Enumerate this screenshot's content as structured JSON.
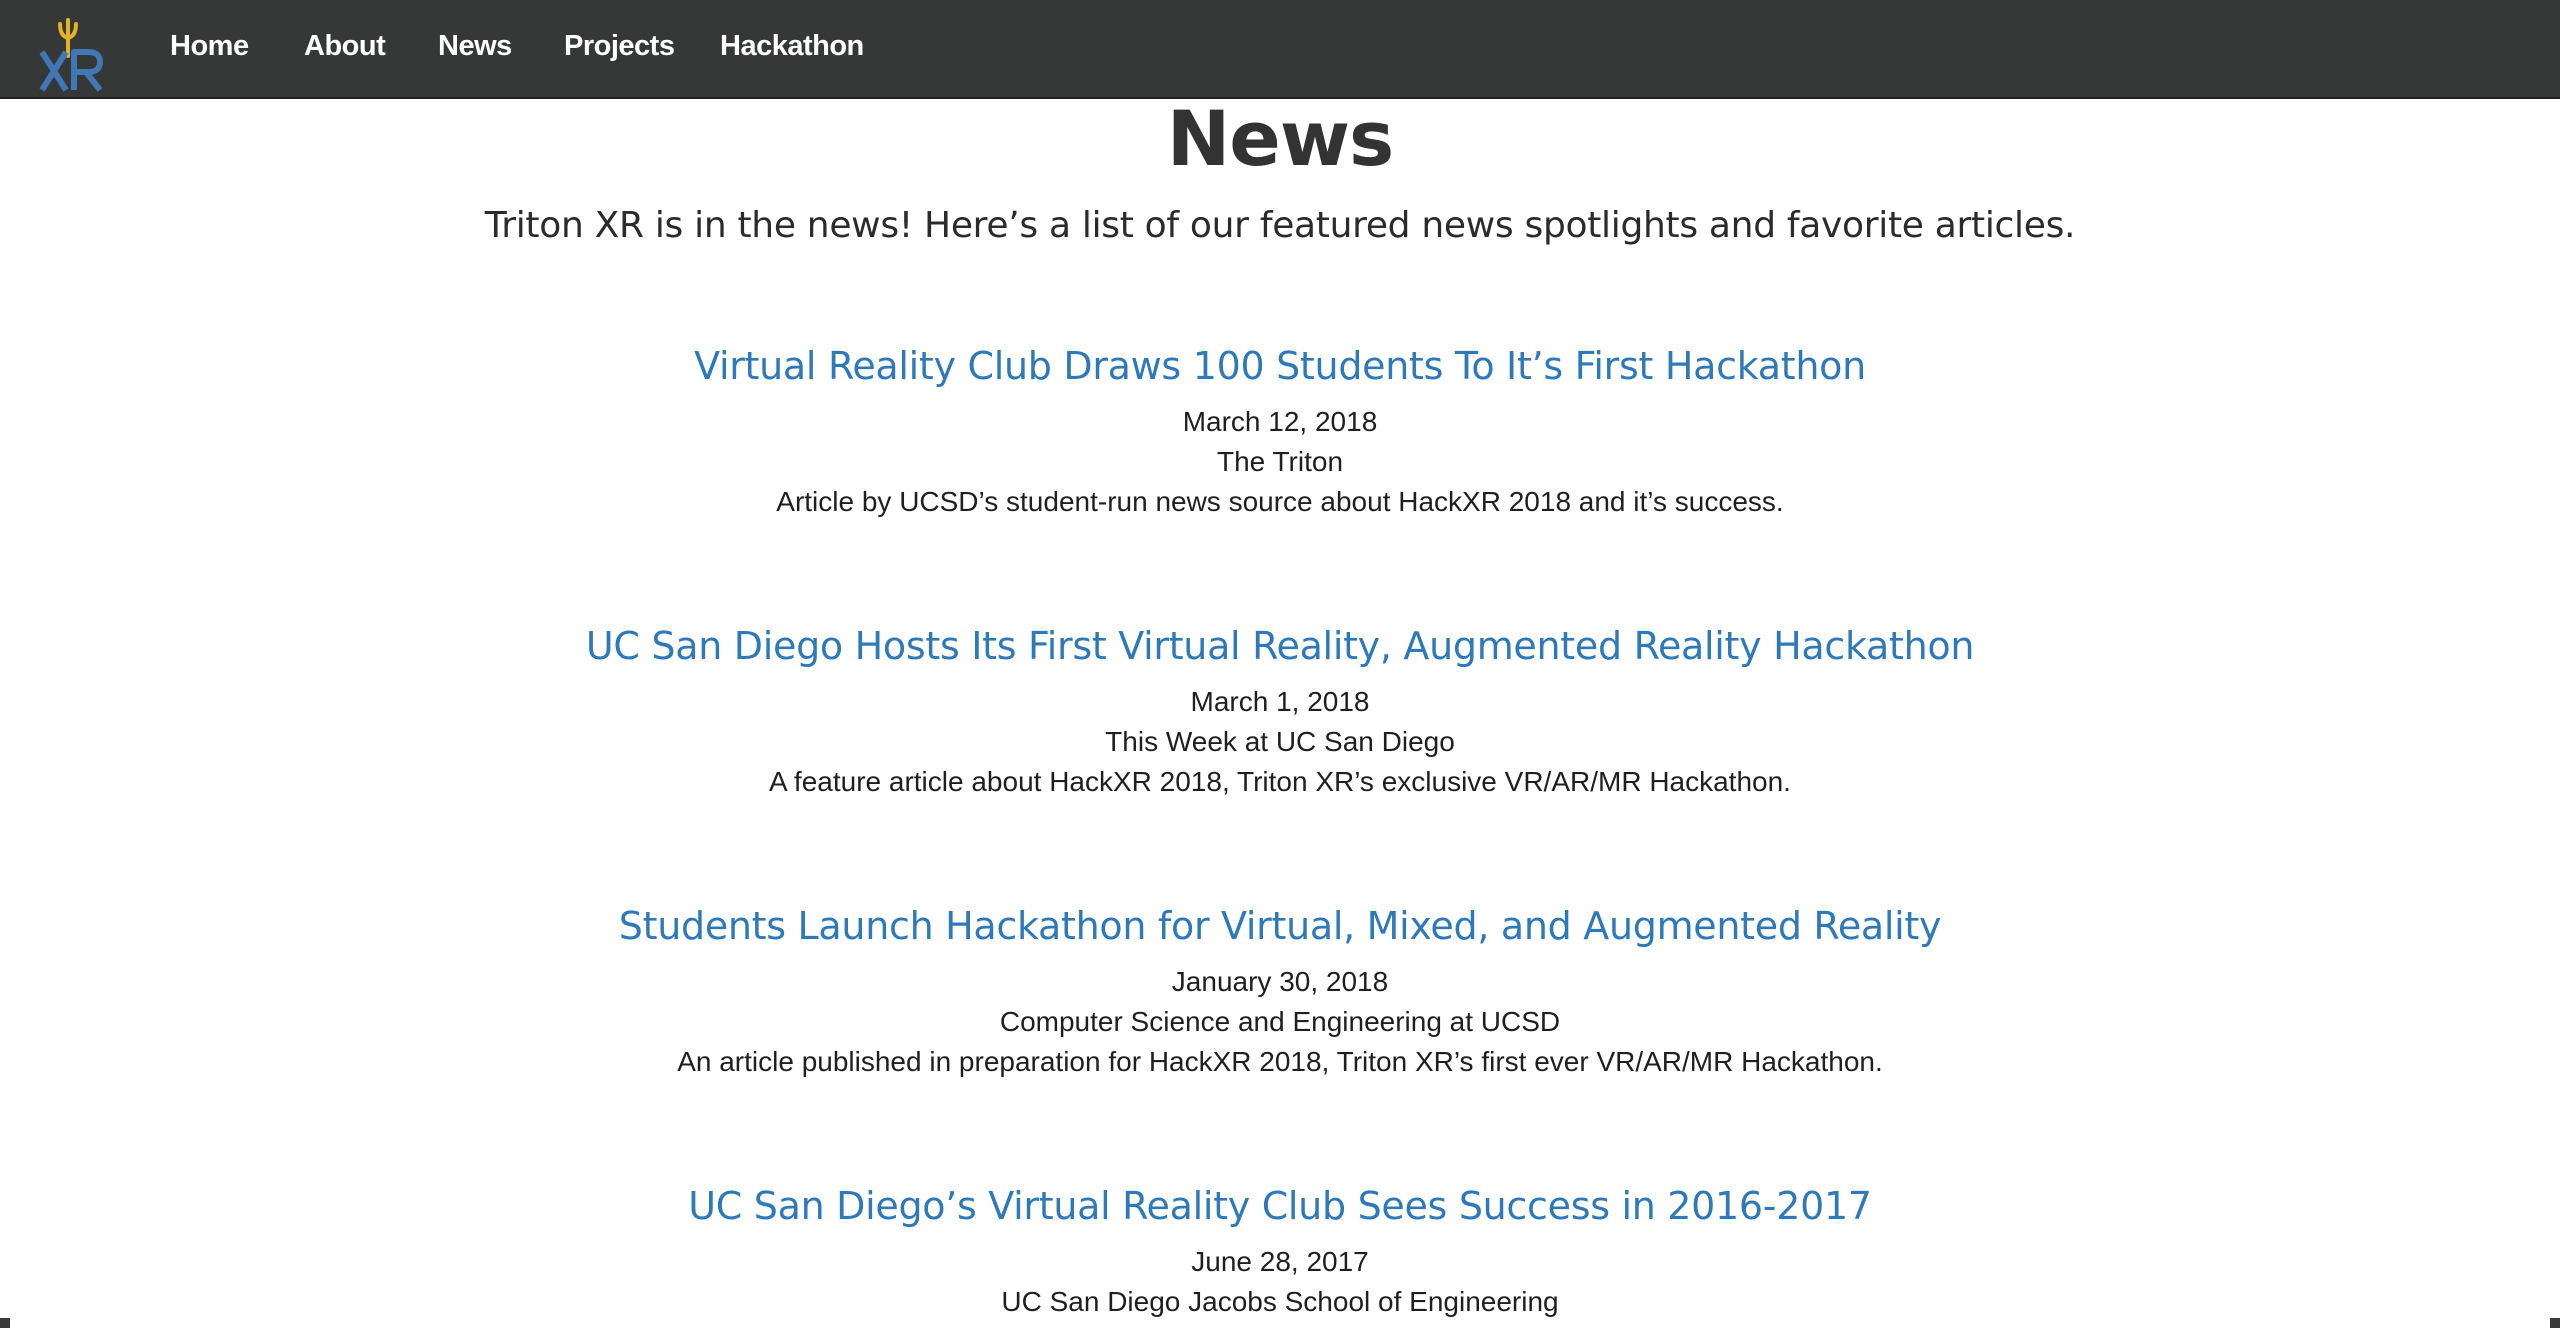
{
  "nav": {
    "logo_alt": "XR",
    "items": [
      {
        "label": "Home"
      },
      {
        "label": "About"
      },
      {
        "label": "News"
      },
      {
        "label": "Projects"
      },
      {
        "label": "Hackathon"
      }
    ]
  },
  "page": {
    "title": "News",
    "subtitle": "Triton XR is in the news! Here’s a list of our featured news spotlights and favorite articles."
  },
  "articles": [
    {
      "title": "Virtual Reality Club Draws 100 Students To It’s First Hackathon",
      "date": "March 12, 2018",
      "source": "The Triton",
      "description": "Article by UCSD’s student-run news source about HackXR 2018 and it’s success."
    },
    {
      "title": "UC San Diego Hosts Its First Virtual Reality, Augmented Reality Hackathon",
      "date": "March 1, 2018",
      "source": "This Week at UC San Diego",
      "description": "A feature article about HackXR 2018, Triton XR’s exclusive VR/AR/MR Hackathon."
    },
    {
      "title": "Students Launch Hackathon for Virtual, Mixed, and Augmented Reality",
      "date": "January 30, 2018",
      "source": "Computer Science and Engineering at UCSD",
      "description": "An article published in preparation for HackXR 2018, Triton XR’s first ever VR/AR/MR Hackathon."
    },
    {
      "title": "UC San Diego’s Virtual Reality Club Sees Success in 2016-2017",
      "date": "June 28, 2017",
      "source": "UC San Diego Jacobs School of Engineering",
      "description": ""
    }
  ],
  "colors": {
    "navbar": "#363737",
    "link": "#2f79b9",
    "logo_blue": "#3f78b5",
    "logo_gold": "#e4b32a"
  }
}
